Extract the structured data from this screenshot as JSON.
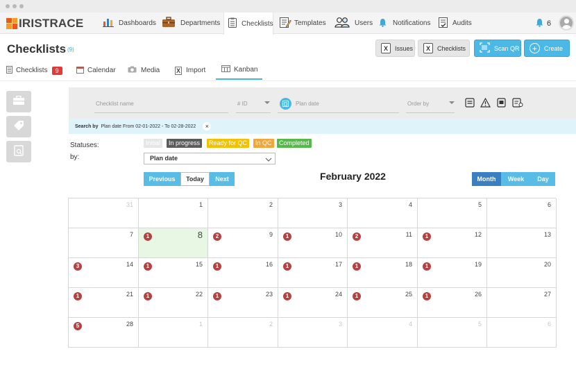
{
  "app": {
    "logo": "IRISTRACE"
  },
  "nav": [
    {
      "label": "Dashboards",
      "icon": "bar-chart-icon"
    },
    {
      "label": "Departments",
      "icon": "briefcase-icon"
    },
    {
      "label": "Checklists",
      "icon": "clipboard-icon"
    },
    {
      "label": "Templates",
      "icon": "template-icon"
    },
    {
      "label": "Users",
      "icon": "users-icon"
    },
    {
      "label": "Notifications",
      "icon": "bell-icon"
    },
    {
      "label": "Audits",
      "icon": "audit-icon"
    }
  ],
  "notifications": {
    "count": "6"
  },
  "header": {
    "title": "Checklists",
    "count": "(9)",
    "buttons": {
      "issues": "Issues",
      "checklists": "Checklists",
      "scan": "Scan QR",
      "create": "Create"
    }
  },
  "tabs": [
    {
      "label": "Checklists",
      "badge": "9"
    },
    {
      "label": "Calendar"
    },
    {
      "label": "Media"
    },
    {
      "label": "Import"
    },
    {
      "label": "Kanban"
    }
  ],
  "filters": {
    "name_placeholder": "Checklist name",
    "id_placeholder": "# ID",
    "date_placeholder": "Plan date",
    "order_placeholder": "Order by"
  },
  "search": {
    "prefix": "Search by",
    "text": "Plan date From 02-01-2022 - To 02-28-2022",
    "clear": "×"
  },
  "statuses": {
    "label": "Statuses:",
    "by_label": "by:",
    "items": [
      {
        "label": "Initial",
        "color": "#e6e6e6",
        "text_color": "#ffffff"
      },
      {
        "label": "In progress",
        "color": "#5b5b5b",
        "text_color": "#ffffff"
      },
      {
        "label": "Ready for QC",
        "color": "#f2c200",
        "text_color": "#ffffff"
      },
      {
        "label": "In QC",
        "color": "#f3a53a",
        "text_color": "#ffffff"
      },
      {
        "label": "Completed",
        "color": "#55b94a",
        "text_color": "#ffffff"
      }
    ],
    "by_value": "Plan date"
  },
  "calendar": {
    "title": "February 2022",
    "nav": {
      "previous": "Previous",
      "today": "Today",
      "next": "Next"
    },
    "views": {
      "month": "Month",
      "week": "Week",
      "day": "Day"
    },
    "weeks": [
      [
        {
          "d": "31",
          "o": true
        },
        {
          "d": "1"
        },
        {
          "d": "2"
        },
        {
          "d": "3"
        },
        {
          "d": "4"
        },
        {
          "d": "5"
        },
        {
          "d": "6"
        }
      ],
      [
        {
          "d": "7"
        },
        {
          "d": "8",
          "c": "1",
          "t": true
        },
        {
          "d": "9",
          "c": "2"
        },
        {
          "d": "10",
          "c": "1"
        },
        {
          "d": "11",
          "c": "2"
        },
        {
          "d": "12",
          "c": "1"
        },
        {
          "d": "13"
        }
      ],
      [
        {
          "d": "14",
          "c": "3"
        },
        {
          "d": "15",
          "c": "1"
        },
        {
          "d": "16",
          "c": "1"
        },
        {
          "d": "17",
          "c": "1"
        },
        {
          "d": "18",
          "c": "1"
        },
        {
          "d": "19",
          "c": "1"
        },
        {
          "d": "20"
        }
      ],
      [
        {
          "d": "21",
          "c": "1"
        },
        {
          "d": "22",
          "c": "1"
        },
        {
          "d": "23",
          "c": "1"
        },
        {
          "d": "24",
          "c": "1"
        },
        {
          "d": "25",
          "c": "1"
        },
        {
          "d": "26",
          "c": "1"
        },
        {
          "d": "27"
        }
      ],
      [
        {
          "d": "28",
          "c": "5"
        },
        {
          "d": "1",
          "o": true
        },
        {
          "d": "2",
          "o": true
        },
        {
          "d": "3",
          "o": true
        },
        {
          "d": "4",
          "o": true
        },
        {
          "d": "5",
          "o": true
        },
        {
          "d": "6",
          "o": true
        }
      ]
    ]
  }
}
